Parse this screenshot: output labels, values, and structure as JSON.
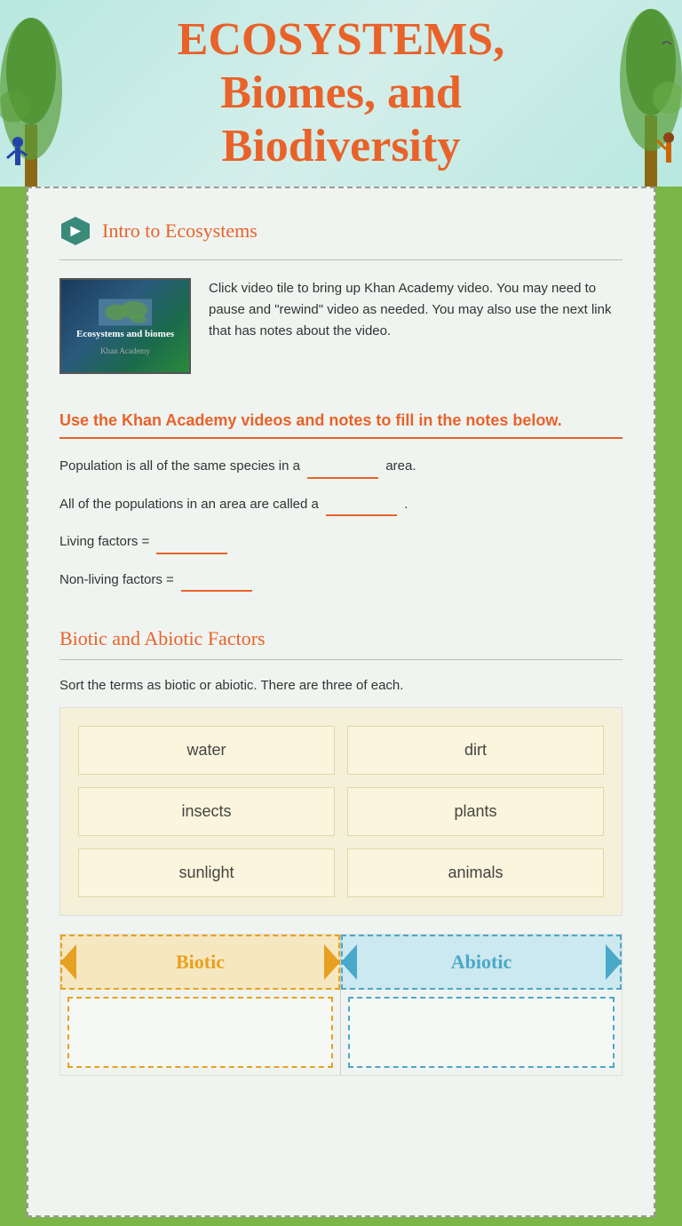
{
  "hero": {
    "title_line1": "ECOSYSTEMS,",
    "title_line2": "Biomes, and",
    "title_line3": "Biodiversity"
  },
  "section1": {
    "title": "Intro to Ecosystems",
    "video_title": "Ecosystems and biomes",
    "video_brand": "Khan Academy",
    "video_description": "Click video tile to bring up Khan Academy video.  You may need to pause and \"rewind\" video as needed.  You may also use the next link that has notes about the video."
  },
  "instruction": {
    "text": "Use the Khan Academy videos and notes to fill in the notes below."
  },
  "fill_blanks": {
    "q1_pre": "Population is all of the same species in a",
    "q1_post": "area.",
    "q2_pre": "All of the populations in an area are called a",
    "q2_post": ".",
    "q3": "Living factors =",
    "q4": "Non-living factors ="
  },
  "section2": {
    "title": "Biotic and Abiotic Factors",
    "instruction": "Sort the terms as biotic or abiotic. There are three of each."
  },
  "terms": [
    {
      "label": "water"
    },
    {
      "label": "dirt"
    },
    {
      "label": "insects"
    },
    {
      "label": "plants"
    },
    {
      "label": "sunlight"
    },
    {
      "label": "animals"
    }
  ],
  "sort_columns": {
    "biotic_label": "Biotic",
    "abiotic_label": "Abiotic"
  }
}
